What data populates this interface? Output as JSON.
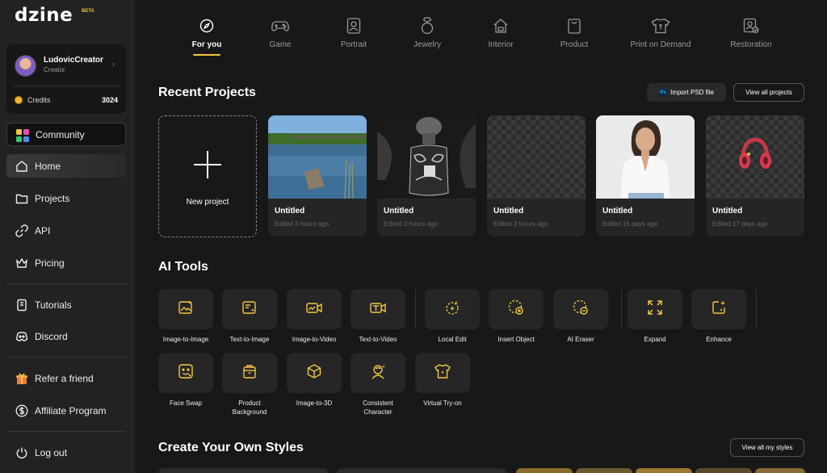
{
  "brand": {
    "logo": "dzine",
    "badge": "BETA",
    "accent": "#f2c744"
  },
  "profile": {
    "name": "LudovicCreator",
    "role": "Creator",
    "credits_label": "Credits",
    "credits_value": "3024"
  },
  "sidebar": {
    "community": "Community",
    "home": "Home",
    "projects": "Projects",
    "api": "API",
    "pricing": "Pricing",
    "tutorials": "Tutorials",
    "discord": "Discord",
    "refer": "Refer a friend",
    "affiliate": "Affiliate Program",
    "logout": "Log out"
  },
  "categories": [
    {
      "label": "For you",
      "icon": "compass-icon",
      "active": true
    },
    {
      "label": "Game",
      "icon": "gamepad-icon"
    },
    {
      "label": "Portrait",
      "icon": "portrait-icon"
    },
    {
      "label": "Jewelry",
      "icon": "ring-icon"
    },
    {
      "label": "Interior",
      "icon": "house-icon"
    },
    {
      "label": "Product",
      "icon": "bag-icon"
    },
    {
      "label": "Print on Demand",
      "icon": "tshirt-icon"
    },
    {
      "label": "Restoration",
      "icon": "photo-restore-icon"
    }
  ],
  "recent": {
    "title": "Recent Projects",
    "import_label": "Import PSD file",
    "ps_badge": "Ps",
    "view_all_label": "View all projects",
    "new_project_label": "New project",
    "projects": [
      {
        "title": "Untitled",
        "date": "Edited 3 hours ago"
      },
      {
        "title": "Untitled",
        "date": "Edited 3 hours ago"
      },
      {
        "title": "Untitled",
        "date": "Edited 3 hours ago"
      },
      {
        "title": "Untitled",
        "date": "Edited 15 days ago"
      },
      {
        "title": "Untitled",
        "date": "Edited 17 days ago"
      }
    ]
  },
  "ai_tools": {
    "title": "AI Tools",
    "items": [
      {
        "label": "Image-to-Image"
      },
      {
        "label": "Text-to-Image"
      },
      {
        "label": "Image-to-Video"
      },
      {
        "label": "Text-to-Video"
      },
      {
        "label": "Local Edit"
      },
      {
        "label": "Insert Object"
      },
      {
        "label": "AI Eraser"
      },
      {
        "label": "Expand"
      },
      {
        "label": "Enhance"
      },
      {
        "label": "Face Swap"
      },
      {
        "label": "Product",
        "label2": "Background"
      },
      {
        "label": "Image-to-3D"
      },
      {
        "label": "Consistent",
        "label2": "Character"
      },
      {
        "label": "Virtual Try-on"
      }
    ]
  },
  "styles": {
    "title": "Create Your Own Styles",
    "view_all_label": "View all my styles"
  }
}
